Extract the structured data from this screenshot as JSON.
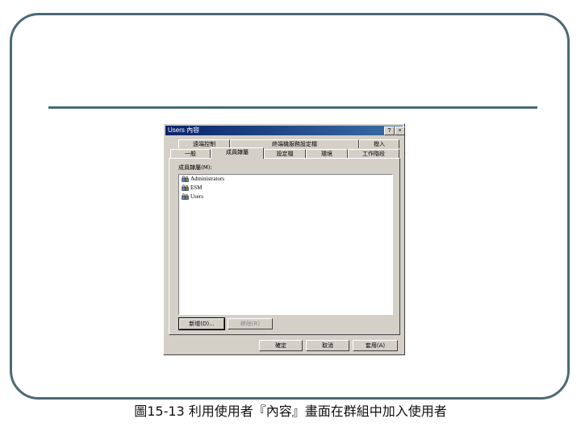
{
  "window": {
    "title": "Users 內容",
    "help_glyph": "?",
    "close_glyph": "×"
  },
  "tabs_row1": [
    {
      "label": "遠端控制"
    },
    {
      "label": "終端機服務設定檔"
    },
    {
      "label": "撥入"
    }
  ],
  "tabs_row2": [
    {
      "label": "一般"
    },
    {
      "label": "成員隸屬"
    },
    {
      "label": "設定檔"
    },
    {
      "label": "環境"
    },
    {
      "label": "工作階段"
    }
  ],
  "group_label": "成員隸屬(M):",
  "members": [
    {
      "name": "Administrators",
      "icon": "group-icon"
    },
    {
      "name": "ESM",
      "icon": "group-icon"
    },
    {
      "name": "Users",
      "icon": "group-icon"
    }
  ],
  "buttons": {
    "add": "新增(D)...",
    "remove": "移除(R)",
    "ok": "確定",
    "cancel": "取消",
    "apply": "套用(A)"
  },
  "caption": "圖15-13 利用使用者『內容』畫面在群組中加入使用者",
  "colors": {
    "frame": "#4a6b73",
    "titlebar_start": "#0a246a",
    "titlebar_end": "#3a6ea5",
    "dialog_face": "#d4d0c8"
  }
}
